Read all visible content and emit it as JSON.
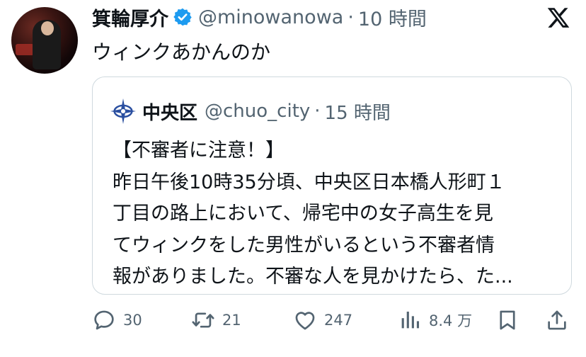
{
  "author": {
    "name": "箕輪厚介",
    "handle": "@minowanowa",
    "separator": "·",
    "time": "10 時間"
  },
  "tweet_text": "ウィンクあかんのか",
  "quoted": {
    "name": "中央区",
    "handle": "@chuo_city",
    "separator": "·",
    "time": "15 時間",
    "lines": [
      "【不審者に注意！】",
      "昨日午後10時35分頃、中央区日本橋人形町１",
      "丁目の路上において、帰宅中の女子高生を見",
      "てウィンクをした男性がいるという不審者情",
      "報がありました。不審な人を見かけたら、た..."
    ]
  },
  "actions": {
    "replies": "30",
    "retweets": "21",
    "likes": "247",
    "views": "8.4 万"
  },
  "icons": {
    "verified": "verified-badge-icon",
    "x_logo": "x-logo-icon",
    "quote_logo": "chuo-city-logo-icon",
    "reply": "reply-icon",
    "retweet": "retweet-icon",
    "like": "heart-icon",
    "views": "views-chart-icon",
    "bookmark": "bookmark-icon",
    "share": "share-icon"
  },
  "colors": {
    "verified": "#1d9bf0",
    "text": "#0f1419",
    "secondary": "#536471",
    "border": "#cfd9de",
    "city_logo": "#2a4fa0"
  }
}
